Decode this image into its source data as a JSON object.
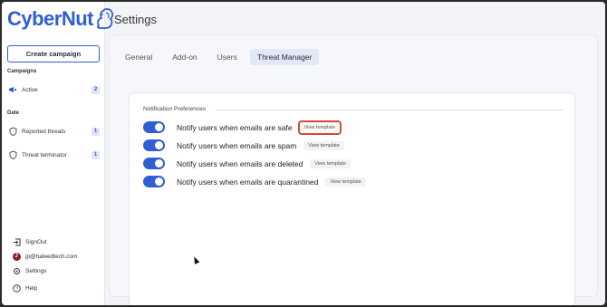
{
  "brand": {
    "name": "CyberNut",
    "color": "#2f5fd0"
  },
  "sidebar": {
    "create_button": "Create campaign",
    "campaigns_label": "Campaigns",
    "campaigns": [
      {
        "label": "Active",
        "count": "2",
        "icon": "megaphone-icon"
      }
    ],
    "date_label": "Date",
    "date_items": [
      {
        "label": "Reported threats",
        "count": "1",
        "icon": "shield-icon"
      },
      {
        "label": "Threat terminator",
        "count": "1",
        "icon": "shield-icon"
      }
    ],
    "bottom": [
      {
        "label": "SignOut",
        "icon": "signout-icon"
      },
      {
        "label": "jp@haleedtech.com",
        "icon": "avatar",
        "initial": "J"
      },
      {
        "label": "Settings",
        "icon": "gear-icon"
      },
      {
        "label": "Help",
        "icon": "help-icon"
      }
    ]
  },
  "main": {
    "title": "Settings",
    "tabs": [
      {
        "label": "General",
        "active": false
      },
      {
        "label": "Add-on",
        "active": false
      },
      {
        "label": "Users",
        "active": false
      },
      {
        "label": "Threat Manager",
        "active": true
      }
    ],
    "card_title": "Notification Preferences",
    "preferences": [
      {
        "label": "Notify users when emails are safe",
        "enabled": true,
        "button": "View template",
        "highlighted": true
      },
      {
        "label": "Notify users when emails are spam",
        "enabled": true,
        "button": "View template",
        "highlighted": false
      },
      {
        "label": "Notify users when emails are deleted",
        "enabled": true,
        "button": "View template",
        "highlighted": false
      },
      {
        "label": "Notify users when emails are quarantined",
        "enabled": true,
        "button": "View template",
        "highlighted": false
      }
    ]
  },
  "colors": {
    "accent": "#2f5fd0",
    "highlight": "#d9463e"
  }
}
